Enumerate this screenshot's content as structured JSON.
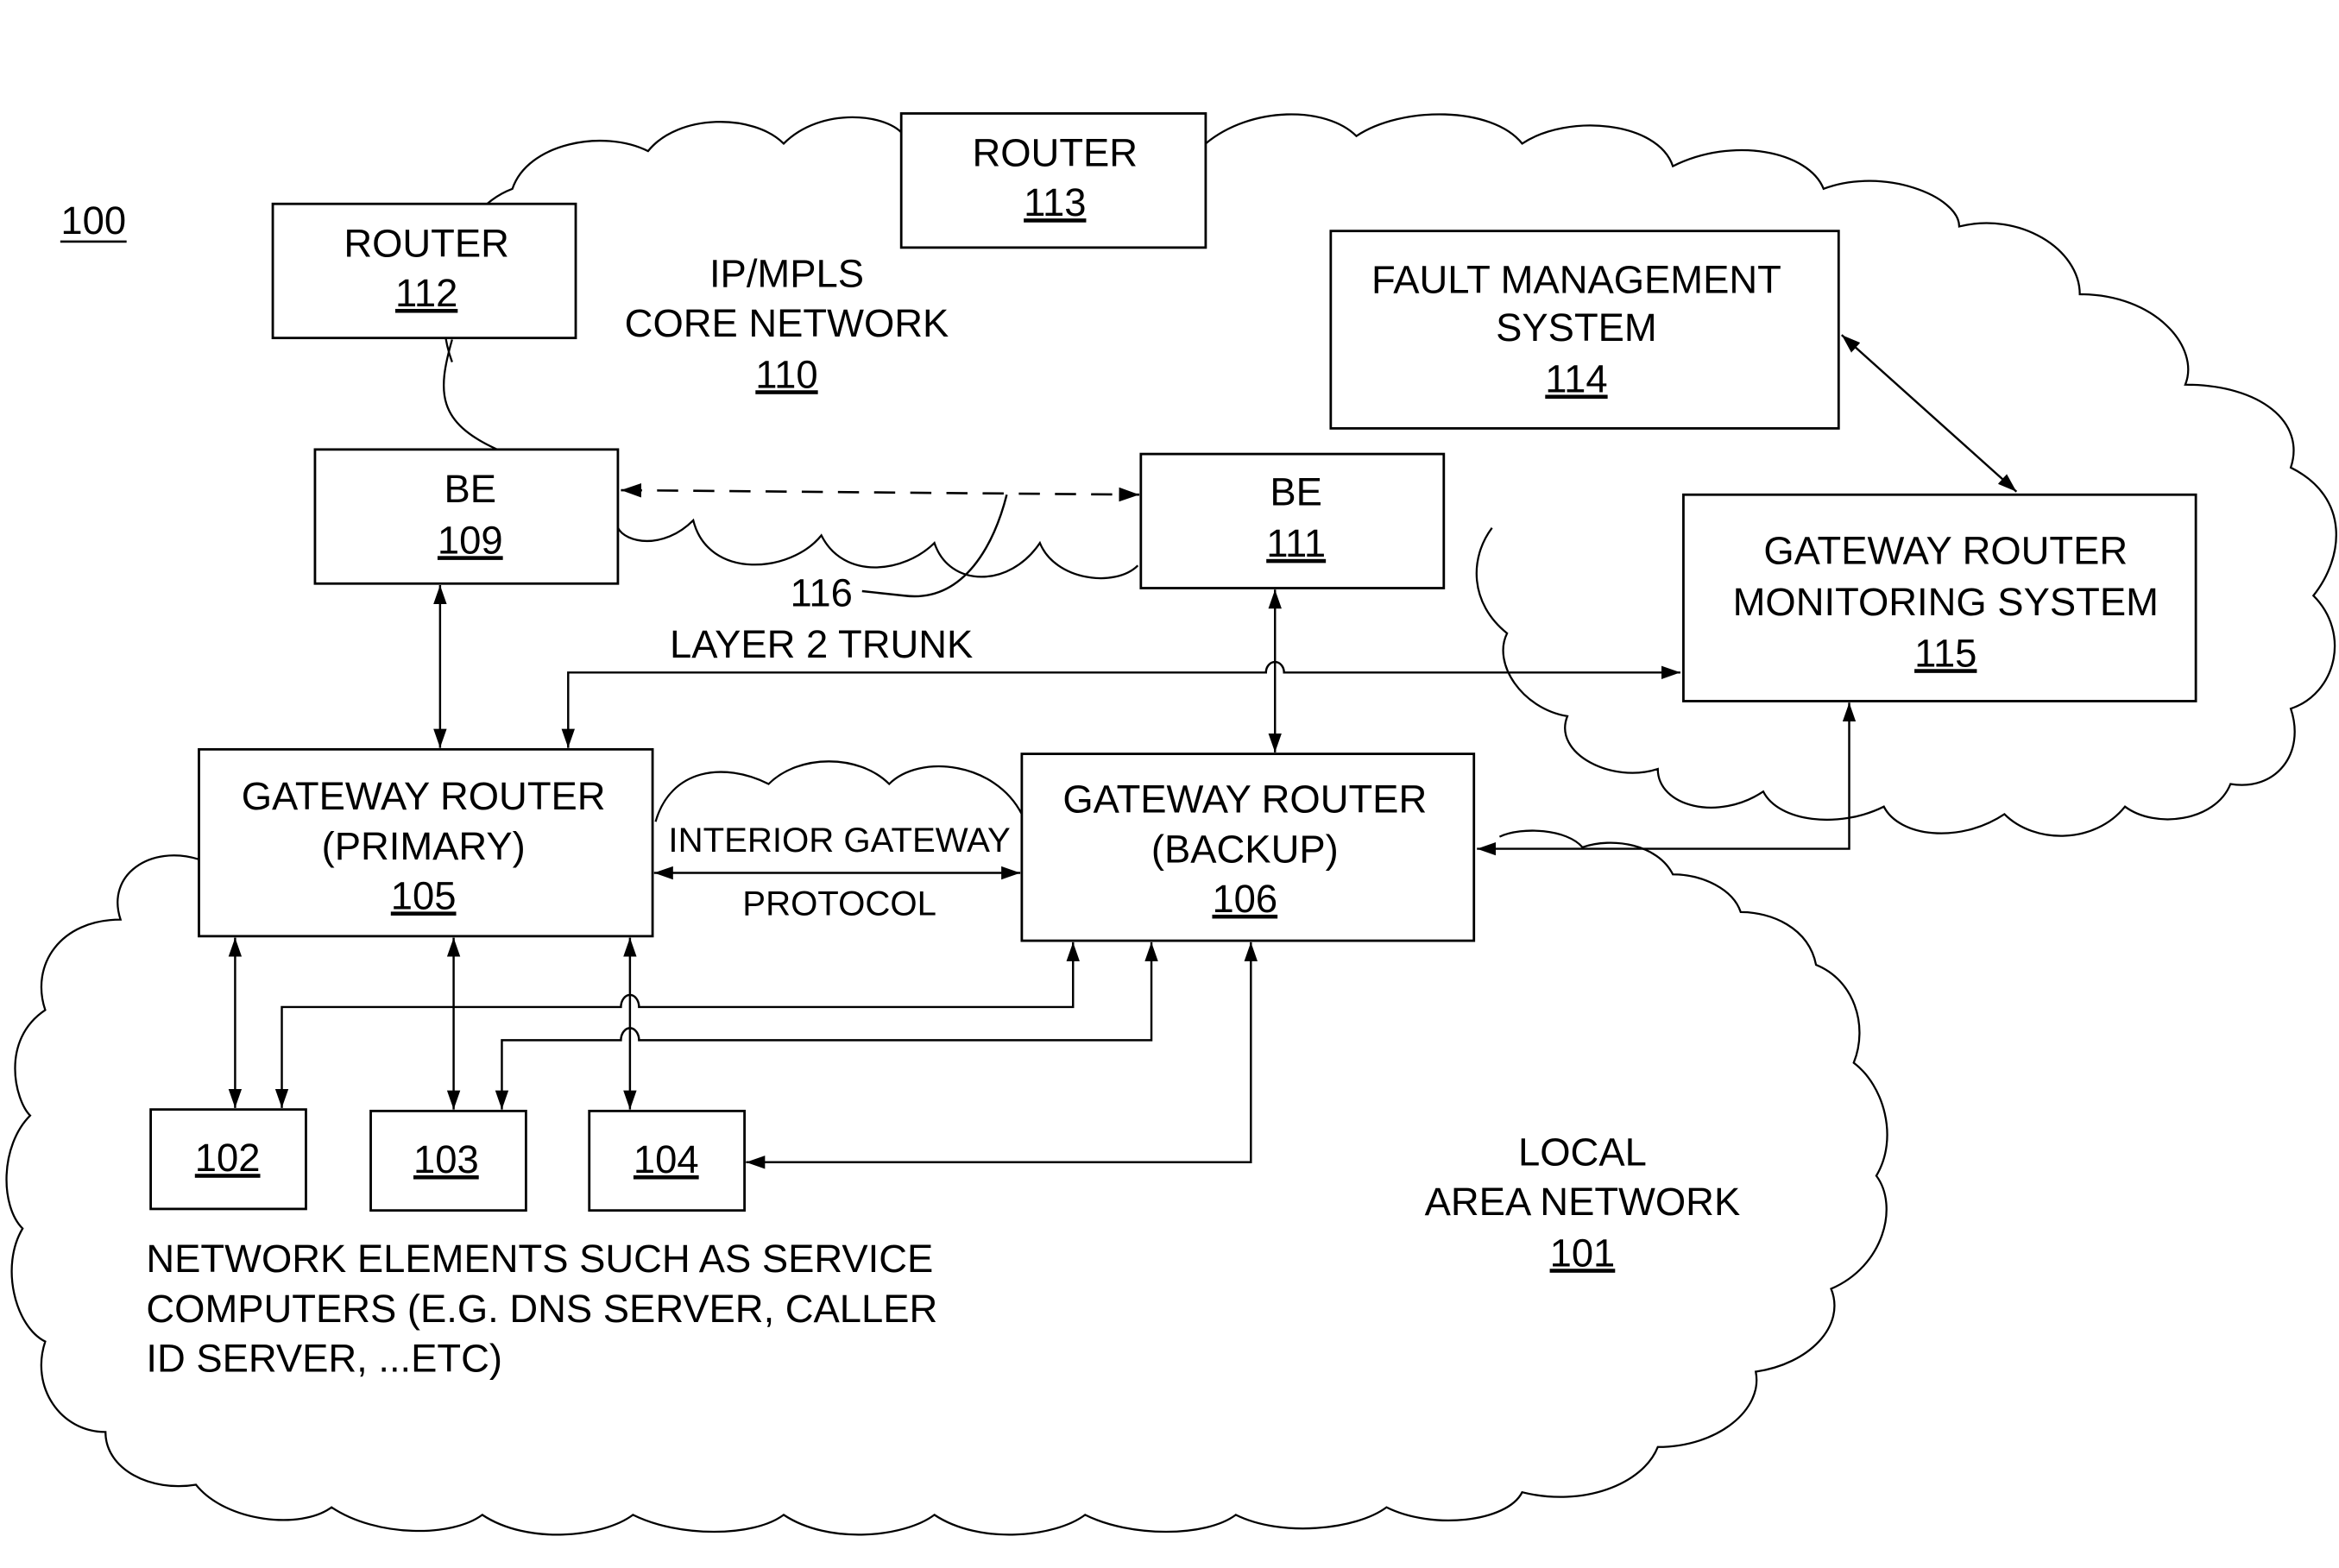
{
  "figure_label": "100",
  "clouds": {
    "core": {
      "line1": "IP/MPLS",
      "line2": "CORE NETWORK",
      "ref": "110"
    },
    "lan": {
      "line1": "LOCAL",
      "line2": "AREA NETWORK",
      "ref": "101"
    }
  },
  "nodes": {
    "router112": {
      "line1": "ROUTER",
      "ref": "112"
    },
    "router113": {
      "line1": "ROUTER",
      "ref": "113"
    },
    "fms": {
      "line1": "FAULT MANAGEMENT",
      "line2": "SYSTEM",
      "ref": "114"
    },
    "be109": {
      "line1": "BE",
      "ref": "109"
    },
    "be111": {
      "line1": "BE",
      "ref": "111"
    },
    "grms": {
      "line1": "GATEWAY ROUTER",
      "line2": "MONITORING SYSTEM",
      "ref": "115"
    },
    "gr105": {
      "line1": "GATEWAY ROUTER",
      "line2": "(PRIMARY)",
      "ref": "105"
    },
    "gr106": {
      "line1": "GATEWAY ROUTER",
      "line2": "(BACKUP)",
      "ref": "106"
    },
    "ne102": {
      "ref": "102"
    },
    "ne103": {
      "ref": "103"
    },
    "ne104": {
      "ref": "104"
    }
  },
  "labels": {
    "trunk_ref": "116",
    "trunk": "LAYER 2 TRUNK",
    "igp1": "INTERIOR GATEWAY",
    "igp2": "PROTOCOL",
    "ne1": "NETWORK ELEMENTS SUCH AS SERVICE",
    "ne2": "COMPUTERS (E.G. DNS SERVER, CALLER",
    "ne3": "ID SERVER, ...ETC)"
  }
}
